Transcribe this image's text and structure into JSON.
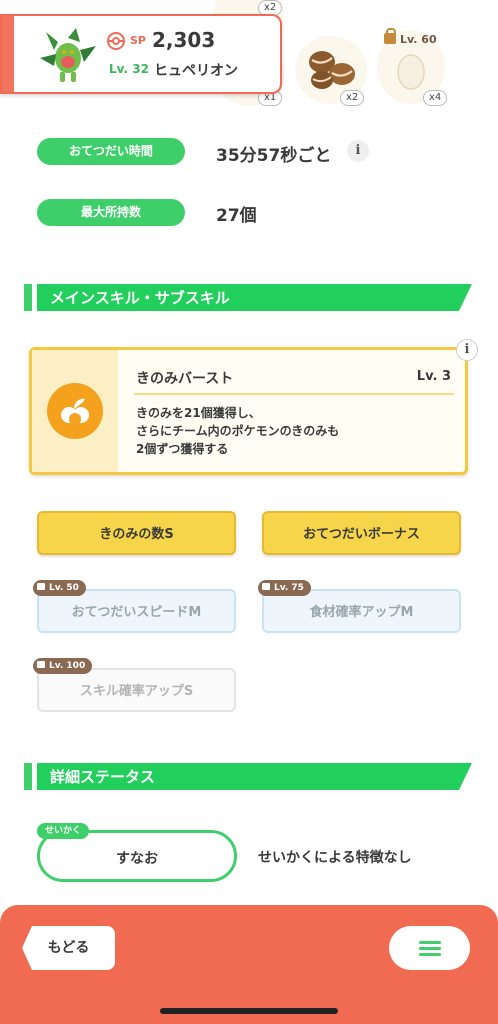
{
  "header": {
    "sp_label": "SP",
    "sp_value": "2,303",
    "level": "Lv. 32",
    "pokemon_name": "ヒュペリオン",
    "ingredients": [
      {
        "icon": "hidden-ingredient-icon",
        "count": "x2"
      },
      {
        "icon": "hidden-ingredient-icon",
        "count": "x1"
      },
      {
        "icon": "coffee-beans-icon",
        "count": "x2"
      },
      {
        "icon": "egg-icon",
        "count": "x4",
        "lock_level": "Lv. 60"
      }
    ]
  },
  "info": {
    "help_time_label": "おてつだい時間",
    "help_time_value": "35分57秒ごと",
    "info_icon": "i",
    "max_carry_label": "最大所持数",
    "max_carry_value": "27個"
  },
  "skills_section": {
    "title": "メインスキル・サブスキル",
    "main_skill": {
      "name": "きのみバースト",
      "level": "Lv. 3",
      "icon": "berry-burst-icon",
      "description_lines": [
        "きのみを21個獲得し、",
        "さらにチーム内のポケモンのきのみも",
        "2個ずつ獲得する"
      ]
    },
    "sub_skills": [
      {
        "label": "きのみの数S",
        "locked": false
      },
      {
        "label": "おてつだいボーナス",
        "locked": false
      },
      {
        "label": "おてつだいスピードM",
        "locked": true,
        "lock_level": "Lv. 50"
      },
      {
        "label": "食材確率アップM",
        "locked": true,
        "lock_level": "Lv. 75"
      },
      {
        "label": "スキル確率アップS",
        "locked": true,
        "lock_level": "Lv. 100"
      }
    ]
  },
  "status_section": {
    "title": "詳細ステータス",
    "nature_tag": "せいかく",
    "nature_value": "すなお",
    "nature_desc": "せいかくによる特徴なし"
  },
  "bottom_bar": {
    "back_label": "もどる",
    "menu_icon": "hamburger-menu-icon"
  },
  "colors": {
    "accent_green": "#22cf5d",
    "accent_coral": "#f16a52",
    "gold": "#f7d54a",
    "locked_blue": "#eef6fc"
  }
}
